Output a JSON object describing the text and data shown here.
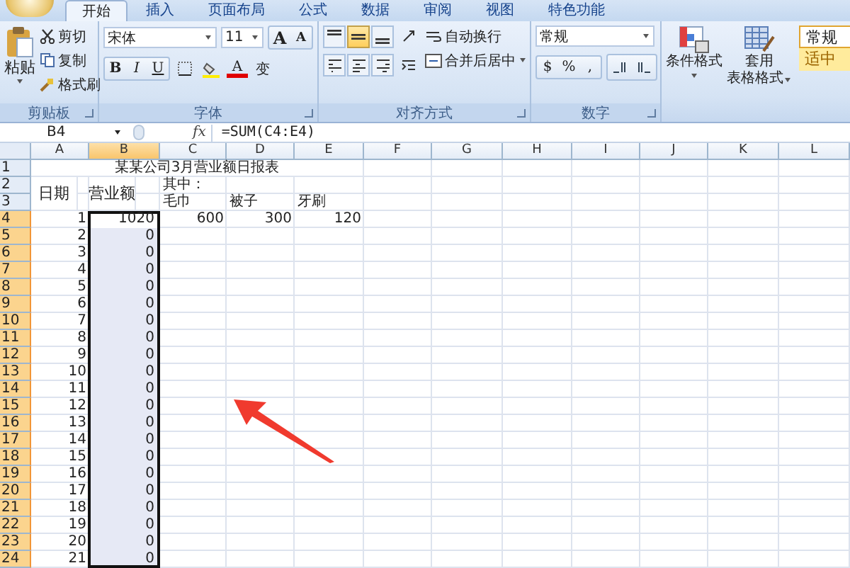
{
  "tabs": [
    {
      "label": "开始",
      "selected": true
    },
    {
      "label": "插入",
      "selected": false
    },
    {
      "label": "页面布局",
      "selected": false
    },
    {
      "label": "公式",
      "selected": false
    },
    {
      "label": "数据",
      "selected": false
    },
    {
      "label": "审阅",
      "selected": false
    },
    {
      "label": "视图",
      "selected": false
    },
    {
      "label": "特色功能",
      "selected": false
    }
  ],
  "clipboard": {
    "paste": "粘贴",
    "cut": "剪切",
    "copy": "复制",
    "format_painter": "格式刷",
    "label": "剪贴板"
  },
  "font": {
    "name": "宋体",
    "size": "11",
    "grow": "A",
    "shrink": "A",
    "bold": "B",
    "italic": "I",
    "underline": "U",
    "color_button": "A",
    "phonetic": "变",
    "label": "字体"
  },
  "alignment": {
    "align_buttons": [
      {
        "kind": "top",
        "selected": false
      },
      {
        "kind": "middle",
        "selected": true
      },
      {
        "kind": "bottom",
        "selected": false
      },
      {
        "kind": "left",
        "selected": false
      },
      {
        "kind": "center",
        "selected": false
      },
      {
        "kind": "right",
        "selected": false
      }
    ],
    "wrap": "自动换行",
    "merge": "合并后居中",
    "label": "对齐方式"
  },
  "number": {
    "format": "常规",
    "currency": "$",
    "percent": "%",
    "comma": ",",
    "label": "数字"
  },
  "styles": {
    "conditional": "条件格式",
    "table_format_line1": "套用",
    "table_format_line2": "表格格式",
    "gallery": [
      "常规",
      "适中"
    ]
  },
  "formula_bar": {
    "name_box": "B4",
    "function_label": "fx",
    "formula": "=SUM(C4:E4)"
  },
  "columns": [
    {
      "label": "A",
      "selected": false
    },
    {
      "label": "B",
      "selected": true
    },
    {
      "label": "C",
      "selected": false
    },
    {
      "label": "D",
      "selected": false
    },
    {
      "label": "E",
      "selected": false
    },
    {
      "label": "F",
      "selected": false
    },
    {
      "label": "G",
      "selected": false
    },
    {
      "label": "H",
      "selected": false
    },
    {
      "label": "I",
      "selected": false
    },
    {
      "label": "J",
      "selected": false
    },
    {
      "label": "K",
      "selected": false
    },
    {
      "label": "L",
      "selected": false
    }
  ],
  "sheet": {
    "title": "某某公司3月营业额日报表",
    "date_header": "日期",
    "revenue_header": "营业额",
    "breakdown_header": "其中：",
    "items": [
      "毛巾",
      "被子",
      "牙刷"
    ],
    "header_rows": [
      {
        "label": "1",
        "selected": false
      },
      {
        "label": "2",
        "selected": false
      },
      {
        "label": "3",
        "selected": false
      }
    ],
    "rows": [
      {
        "label": "4",
        "selected": true,
        "date": "1",
        "revenue": "1020",
        "values": [
          "600",
          "300",
          "120"
        ]
      },
      {
        "label": "5",
        "selected": true,
        "date": "2",
        "revenue": "0"
      },
      {
        "label": "6",
        "selected": true,
        "date": "3",
        "revenue": "0"
      },
      {
        "label": "7",
        "selected": true,
        "date": "4",
        "revenue": "0"
      },
      {
        "label": "8",
        "selected": true,
        "date": "5",
        "revenue": "0"
      },
      {
        "label": "9",
        "selected": true,
        "date": "6",
        "revenue": "0"
      },
      {
        "label": "10",
        "selected": true,
        "date": "7",
        "revenue": "0"
      },
      {
        "label": "11",
        "selected": true,
        "date": "8",
        "revenue": "0"
      },
      {
        "label": "12",
        "selected": true,
        "date": "9",
        "revenue": "0"
      },
      {
        "label": "13",
        "selected": true,
        "date": "10",
        "revenue": "0"
      },
      {
        "label": "14",
        "selected": true,
        "date": "11",
        "revenue": "0"
      },
      {
        "label": "15",
        "selected": true,
        "date": "12",
        "revenue": "0"
      },
      {
        "label": "16",
        "selected": true,
        "date": "13",
        "revenue": "0"
      },
      {
        "label": "17",
        "selected": true,
        "date": "14",
        "revenue": "0"
      },
      {
        "label": "18",
        "selected": true,
        "date": "15",
        "revenue": "0"
      },
      {
        "label": "19",
        "selected": true,
        "date": "16",
        "revenue": "0"
      },
      {
        "label": "20",
        "selected": true,
        "date": "17",
        "revenue": "0"
      },
      {
        "label": "21",
        "selected": true,
        "date": "18",
        "revenue": "0"
      },
      {
        "label": "22",
        "selected": true,
        "date": "19",
        "revenue": "0"
      },
      {
        "label": "23",
        "selected": true,
        "date": "20",
        "revenue": "0"
      },
      {
        "label": "24",
        "selected": true,
        "date": "21",
        "revenue": "0"
      }
    ]
  }
}
